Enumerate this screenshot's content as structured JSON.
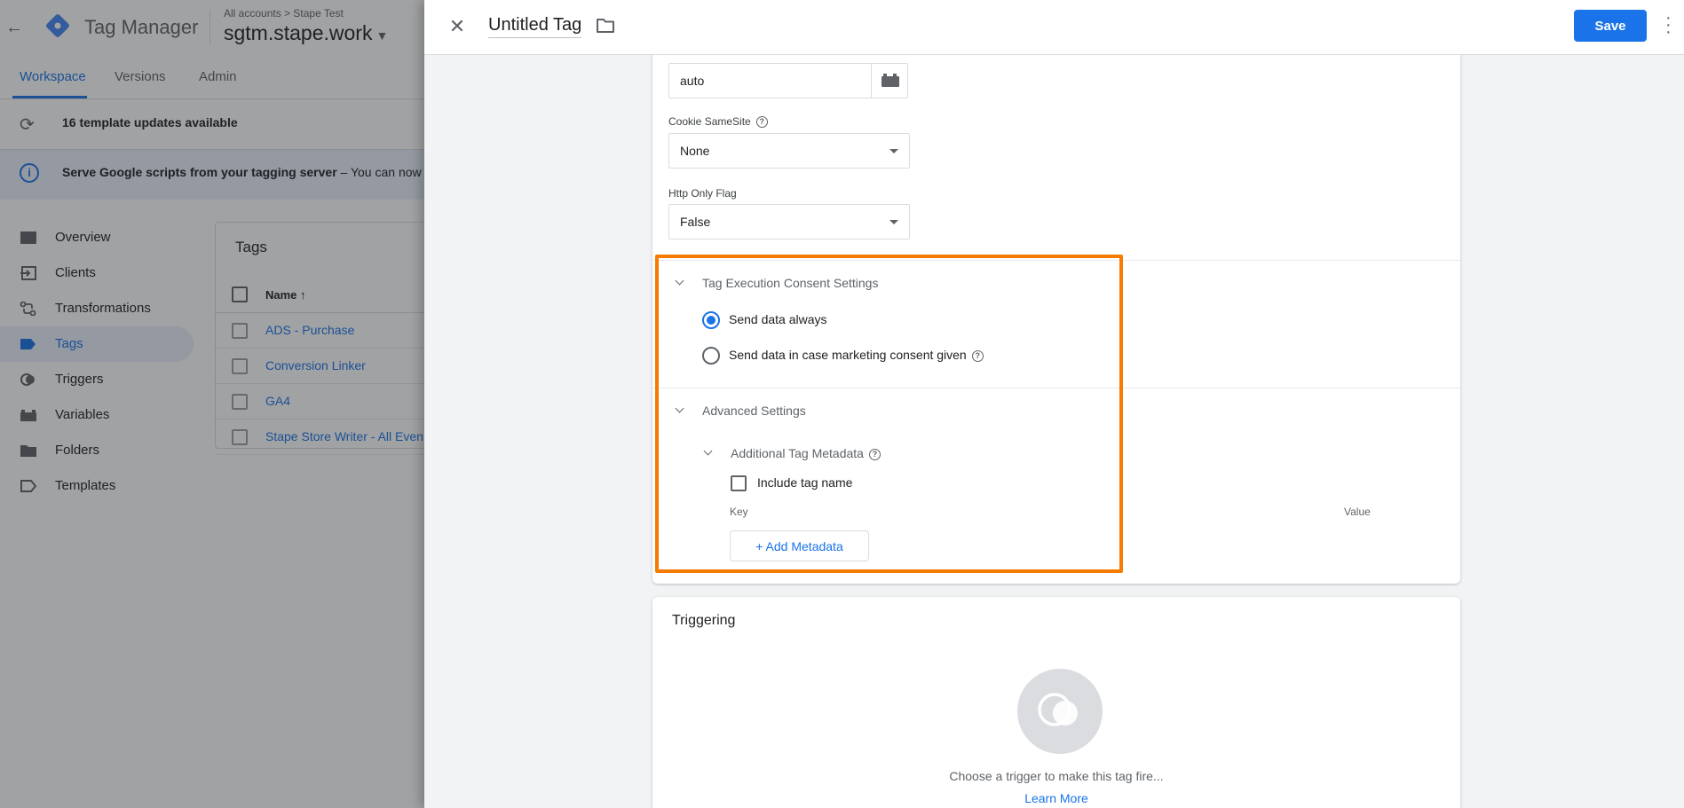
{
  "workspace": {
    "app_title": "Tag Manager",
    "breadcrumb": {
      "accounts": "All accounts",
      "account": "Stape Test"
    },
    "container_name": "sgtm.stape.work",
    "tabs": [
      {
        "label": "Workspace"
      },
      {
        "label": "Versions"
      },
      {
        "label": "Admin"
      }
    ],
    "updates_text": "16 template updates available",
    "info_banner": {
      "bold": "Serve Google scripts from your tagging server",
      "rest": " – You can now se"
    },
    "nav": [
      {
        "label": "Overview",
        "icon": "overview-icon"
      },
      {
        "label": "Clients",
        "icon": "clients-icon"
      },
      {
        "label": "Transformations",
        "icon": "transformations-icon"
      },
      {
        "label": "Tags",
        "icon": "tags-icon"
      },
      {
        "label": "Triggers",
        "icon": "triggers-icon"
      },
      {
        "label": "Variables",
        "icon": "variables-icon"
      },
      {
        "label": "Folders",
        "icon": "folders-icon"
      },
      {
        "label": "Templates",
        "icon": "templates-icon"
      }
    ],
    "active_nav": "Tags",
    "tags_card": {
      "title": "Tags",
      "column_name": "Name ↑",
      "rows": [
        "ADS - Purchase",
        "Conversion Linker",
        "GA4",
        "Stape Store Writer - All Even"
      ]
    }
  },
  "editor": {
    "tag_name": "Untitled Tag",
    "save_label": "Save",
    "cookie_domain_value": "auto",
    "cookie_samesite": {
      "label": "Cookie SameSite",
      "value": "None"
    },
    "http_only": {
      "label": "Http Only Flag",
      "value": "False"
    },
    "consent": {
      "title": "Tag Execution Consent Settings",
      "options": [
        {
          "label": "Send data always",
          "checked": true
        },
        {
          "label": "Send data in case marketing consent given",
          "checked": false
        }
      ]
    },
    "advanced": {
      "title": "Advanced Settings",
      "metadata_title": "Additional Tag Metadata",
      "include_tag_name": "Include tag name",
      "key_label": "Key",
      "value_label": "Value",
      "add_metadata_label": "+ Add Metadata"
    },
    "triggering": {
      "title": "Triggering",
      "hint": "Choose a trigger to make this tag fire...",
      "learn_more": "Learn More"
    }
  },
  "colors": {
    "accent": "#1a73e8",
    "highlight": "#f57c00"
  }
}
